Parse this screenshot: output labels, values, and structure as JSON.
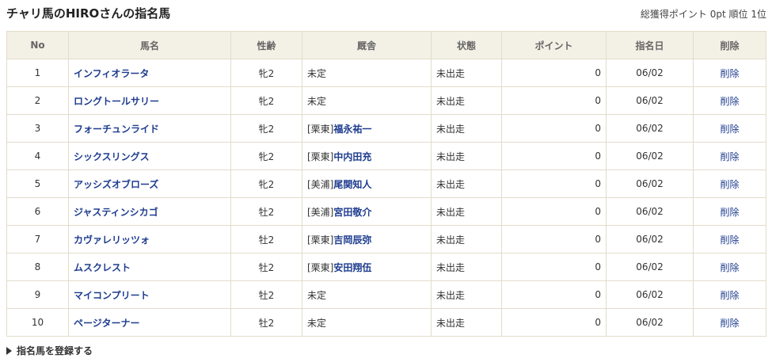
{
  "header": {
    "title": "チャリ馬のHIROさんの指名馬",
    "total_points_label": "総獲得ポイント",
    "total_points": "0pt",
    "rank_label": "順位",
    "rank": "1位"
  },
  "table": {
    "columns": [
      "No",
      "馬名",
      "性齢",
      "厩舎",
      "状態",
      "ポイント",
      "指名日",
      "削除"
    ],
    "rows": [
      {
        "no": "1",
        "name": "インフィオラータ",
        "sexage": "牝2",
        "stable_plain": "未定",
        "stable_region": "",
        "trainer": "",
        "status": "未出走",
        "points": "0",
        "date": "06/02",
        "delete": "削除"
      },
      {
        "no": "2",
        "name": "ロングトールサリー",
        "sexage": "牝2",
        "stable_plain": "未定",
        "stable_region": "",
        "trainer": "",
        "status": "未出走",
        "points": "0",
        "date": "06/02",
        "delete": "削除"
      },
      {
        "no": "3",
        "name": "フォーチュンライド",
        "sexage": "牝2",
        "stable_plain": "",
        "stable_region": "[栗東]",
        "trainer": "福永祐一",
        "status": "未出走",
        "points": "0",
        "date": "06/02",
        "delete": "削除"
      },
      {
        "no": "4",
        "name": "シックスリングス",
        "sexage": "牝2",
        "stable_plain": "",
        "stable_region": "[栗東]",
        "trainer": "中内田充",
        "status": "未出走",
        "points": "0",
        "date": "06/02",
        "delete": "削除"
      },
      {
        "no": "5",
        "name": "アッシズオブローズ",
        "sexage": "牝2",
        "stable_plain": "",
        "stable_region": "[美浦]",
        "trainer": "尾関知人",
        "status": "未出走",
        "points": "0",
        "date": "06/02",
        "delete": "削除"
      },
      {
        "no": "6",
        "name": "ジャスティンシカゴ",
        "sexage": "牡2",
        "stable_plain": "",
        "stable_region": "[美浦]",
        "trainer": "宮田敬介",
        "status": "未出走",
        "points": "0",
        "date": "06/02",
        "delete": "削除"
      },
      {
        "no": "7",
        "name": "カヴァレリッツォ",
        "sexage": "牡2",
        "stable_plain": "",
        "stable_region": "[栗東]",
        "trainer": "吉岡辰弥",
        "status": "未出走",
        "points": "0",
        "date": "06/02",
        "delete": "削除"
      },
      {
        "no": "8",
        "name": "ムスクレスト",
        "sexage": "牡2",
        "stable_plain": "",
        "stable_region": "[栗東]",
        "trainer": "安田翔伍",
        "status": "未出走",
        "points": "0",
        "date": "06/02",
        "delete": "削除"
      },
      {
        "no": "9",
        "name": "マイコンプリート",
        "sexage": "牡2",
        "stable_plain": "未定",
        "stable_region": "",
        "trainer": "",
        "status": "未出走",
        "points": "0",
        "date": "06/02",
        "delete": "削除"
      },
      {
        "no": "10",
        "name": "ページターナー",
        "sexage": "牡2",
        "stable_plain": "未定",
        "stable_region": "",
        "trainer": "",
        "status": "未出走",
        "points": "0",
        "date": "06/02",
        "delete": "削除"
      }
    ]
  },
  "footer": {
    "register_label": "指名馬を登録する"
  },
  "colors": {
    "link": "#1f3d8f",
    "header_bg": "#f3f0e6",
    "border": "#e2dccb"
  }
}
